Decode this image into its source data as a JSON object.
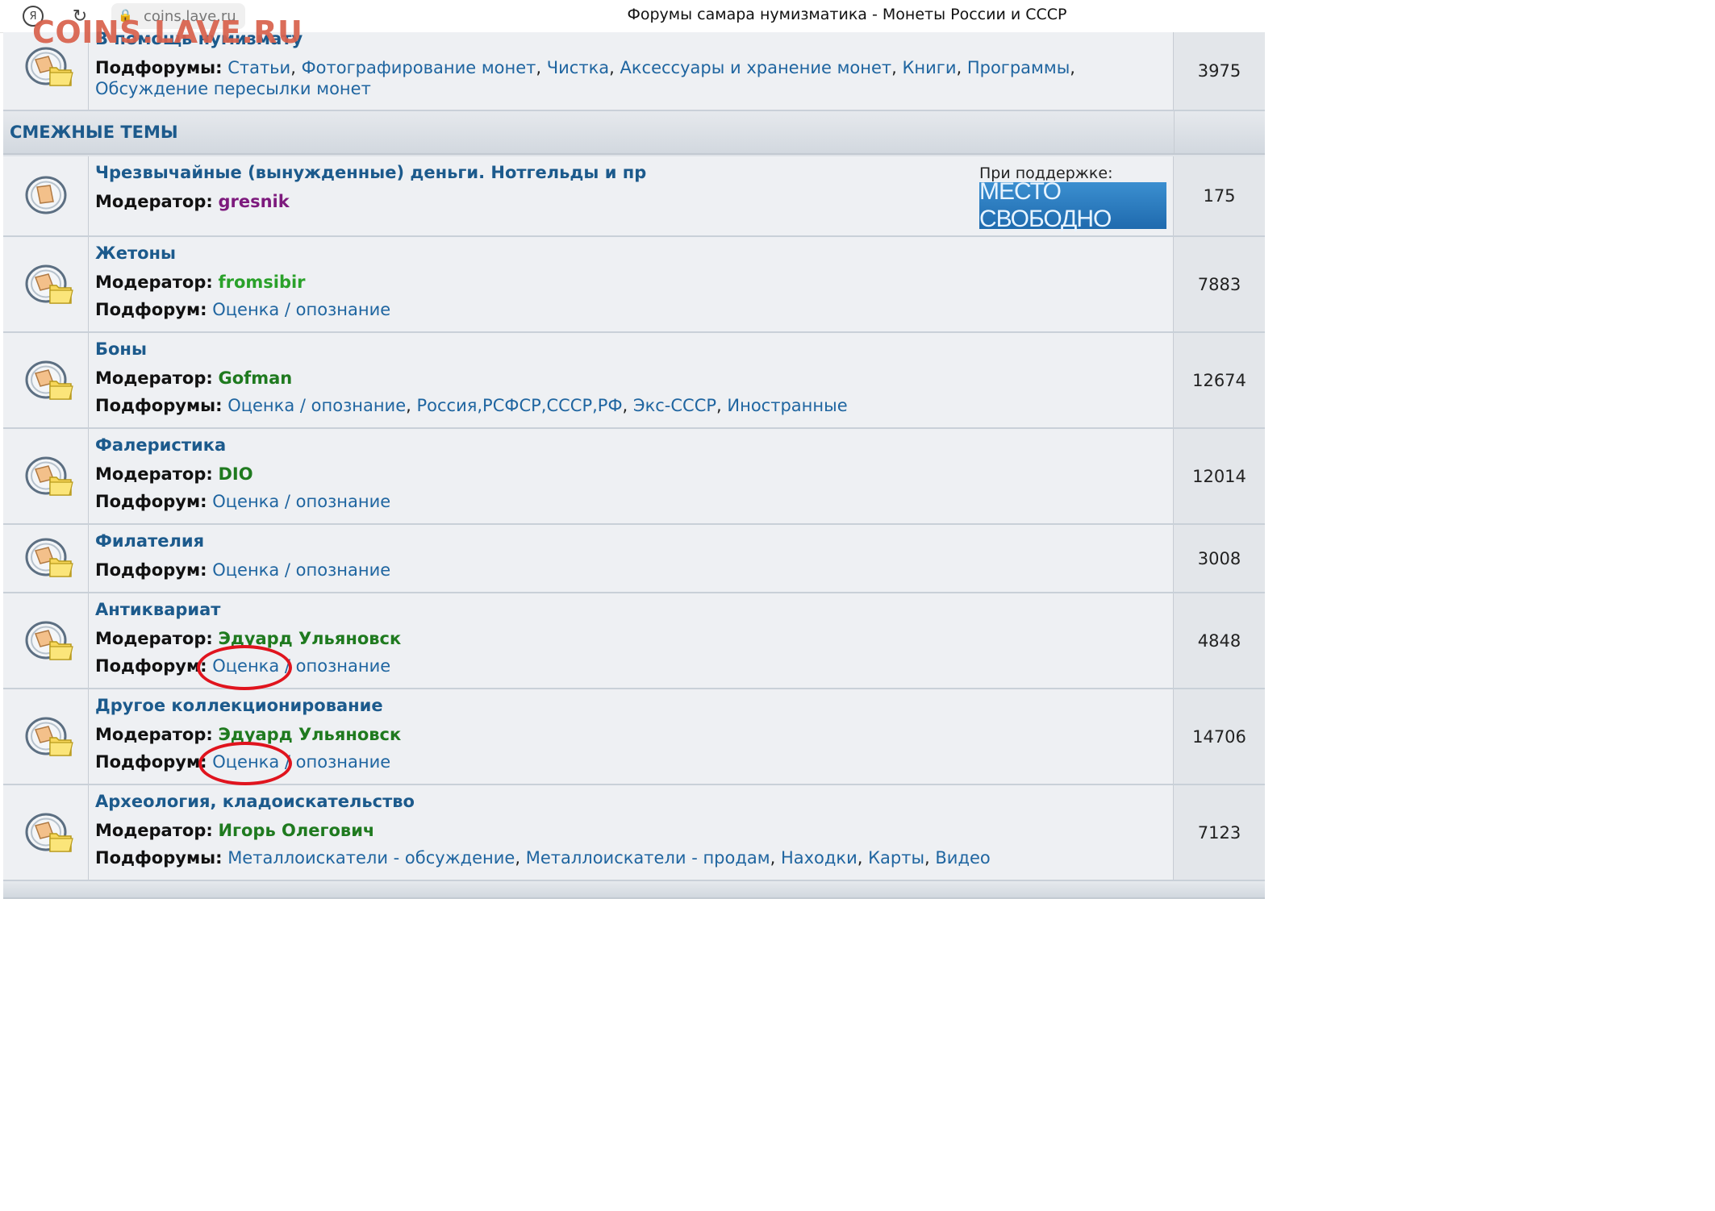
{
  "browser": {
    "ya_icon": "Я",
    "reload_icon": "reload-icon",
    "lock_icon": "lock-icon",
    "url": "coins.lave.ru",
    "tab_title": "Форумы самара нумизматика - Монеты России и СССР"
  },
  "watermark": "COINS.LAVE.RU",
  "top_forum": {
    "title": "В помощь нумизмату",
    "subforums_label": "Подфорумы:",
    "subforums": [
      "Статьи",
      "Фотографирование монет",
      "Чистка",
      "Аксессуары и хранение монет",
      "Книги",
      "Программы",
      "Обсуждение пересылки монет"
    ],
    "count": "3975"
  },
  "category": {
    "title": "СМЕЖНЫЕ ТЕМЫ"
  },
  "sponsor": {
    "label": "При поддержке:",
    "banner": "МЕСТО СВОБОДНО"
  },
  "forums": [
    {
      "title": "Чрезвычайные (вынужденные) деньги. Нотгельды и пр",
      "moderator_label": "Модератор:",
      "moderator": "gresnik",
      "count": "175"
    },
    {
      "title": "Жетоны",
      "moderator_label": "Модератор:",
      "moderator": "fromsibir",
      "subforum_label": "Подфорум:",
      "subforums": [
        "Оценка / опознание"
      ],
      "count": "7883"
    },
    {
      "title": "Боны",
      "moderator_label": "Модератор:",
      "moderator": "Gofman",
      "subforum_label": "Подфорумы:",
      "subforums": [
        "Оценка / опознание",
        "Россия,РСФСР,СССР,РФ",
        "Экс-СССР",
        "Иностранные"
      ],
      "count": "12674"
    },
    {
      "title": "Фалеристика",
      "moderator_label": "Модератор:",
      "moderator": "DIO",
      "subforum_label": "Подфорум:",
      "subforums": [
        "Оценка / опознание"
      ],
      "count": "12014"
    },
    {
      "title": "Филателия",
      "subforum_label": "Подфорум:",
      "subforums": [
        "Оценка / опознание"
      ],
      "count": "3008"
    },
    {
      "title": "Антиквариат",
      "moderator_label": "Модератор:",
      "moderator": "Эдуард Ульяновск",
      "subforum_label": "Подфорум:",
      "subforums": [
        "Оценка / опознание"
      ],
      "count": "4848"
    },
    {
      "title": "Другое коллекционирование",
      "moderator_label": "Модератор:",
      "moderator": "Эдуард Ульяновск",
      "subforum_label": "Подфорум:",
      "subforums": [
        "Оценка / опознание"
      ],
      "count": "14706"
    },
    {
      "title": "Археология, кладоискательство",
      "moderator_label": "Модератор:",
      "moderator": "Игорь Олегович",
      "subforum_label": "Подфорумы:",
      "subforums": [
        "Металлоискатели - обсуждение",
        "Металлоискатели - продам",
        "Находки",
        "Карты",
        "Видео"
      ],
      "count": "7123"
    }
  ]
}
